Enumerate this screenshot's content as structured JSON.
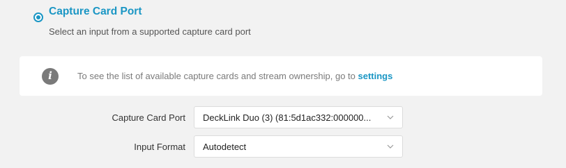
{
  "option": {
    "title": "Capture Card Port",
    "description": "Select an input from a supported capture card port",
    "selected": true
  },
  "info": {
    "text": "To see the list of available capture cards and stream ownership, go to ",
    "link_label": "settings",
    "icon": "info-icon"
  },
  "form": {
    "capture_card_port": {
      "label": "Capture Card Port",
      "value": "DeckLink Duo (3) (81:5d1ac332:000000..."
    },
    "input_format": {
      "label": "Input Format",
      "value": "Autodetect"
    }
  },
  "colors": {
    "accent": "#1a96c4",
    "background": "#f2f2f2",
    "panel": "#ffffff",
    "muted_text": "#7a7a7a"
  }
}
